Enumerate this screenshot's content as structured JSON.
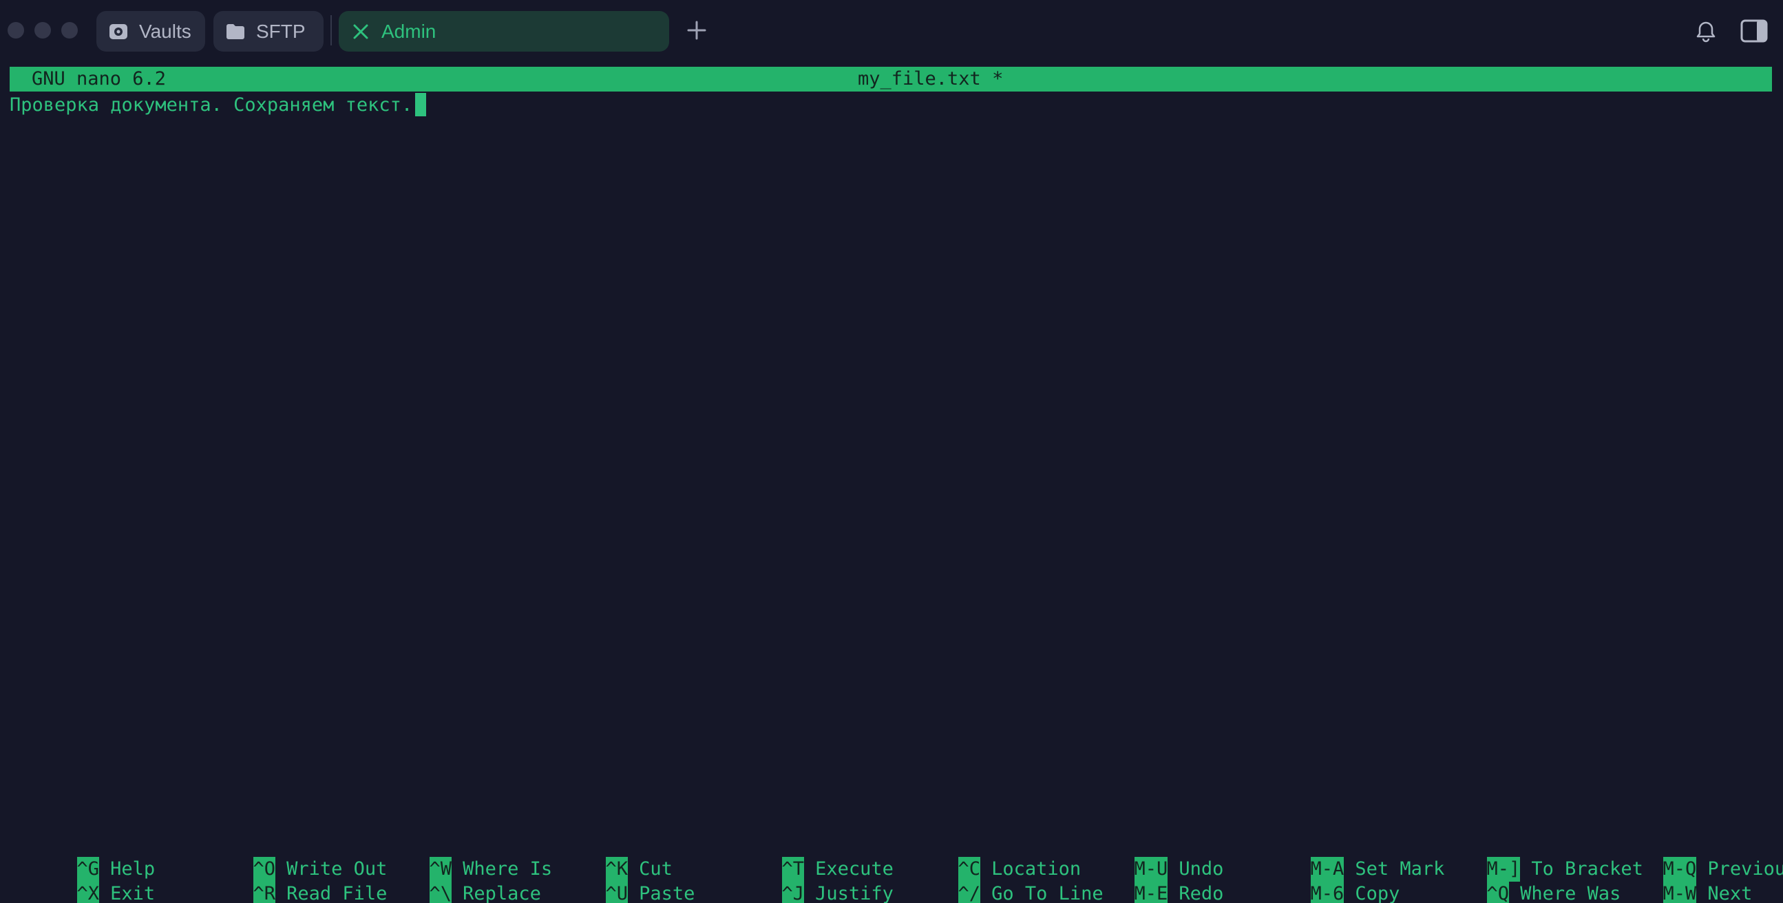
{
  "window": {
    "tabs": [
      {
        "label": "Vaults",
        "icon": "vault-icon",
        "active": false
      },
      {
        "label": "SFTP",
        "icon": "folder-icon",
        "active": false
      },
      {
        "label": "Admin",
        "icon": "close-icon",
        "active": true
      }
    ],
    "new_tab_icon": "plus-icon",
    "notifications_icon": "bell-icon",
    "sidebar_icon": "sidebar-toggle-icon"
  },
  "nano": {
    "version": "GNU nano 6.2",
    "filename": "my_file.txt *",
    "content": "Проверка документа. Сохраняем текст.",
    "shortcuts_row1": [
      {
        "key": "^G",
        "label": "Help"
      },
      {
        "key": "^O",
        "label": "Write Out"
      },
      {
        "key": "^W",
        "label": "Where Is"
      },
      {
        "key": "^K",
        "label": "Cut"
      },
      {
        "key": "^T",
        "label": "Execute"
      },
      {
        "key": "^C",
        "label": "Location"
      },
      {
        "key": "M-U",
        "label": "Undo"
      },
      {
        "key": "M-A",
        "label": "Set Mark"
      },
      {
        "key": "M-]",
        "label": "To Bracket"
      },
      {
        "key": "M-Q",
        "label": "Previous"
      }
    ],
    "shortcuts_row2": [
      {
        "key": "^X",
        "label": "Exit"
      },
      {
        "key": "^R",
        "label": "Read File"
      },
      {
        "key": "^\\",
        "label": "Replace"
      },
      {
        "key": "^U",
        "label": "Paste"
      },
      {
        "key": "^J",
        "label": "Justify"
      },
      {
        "key": "^/",
        "label": "Go To Line"
      },
      {
        "key": "M-E",
        "label": "Redo"
      },
      {
        "key": "M-6",
        "label": "Copy"
      },
      {
        "key": "^Q",
        "label": "Where Was"
      },
      {
        "key": "M-W",
        "label": "Next"
      }
    ]
  },
  "colors": {
    "background": "#151728",
    "accent": "#2ec27e",
    "highlight": "#24b36b"
  }
}
